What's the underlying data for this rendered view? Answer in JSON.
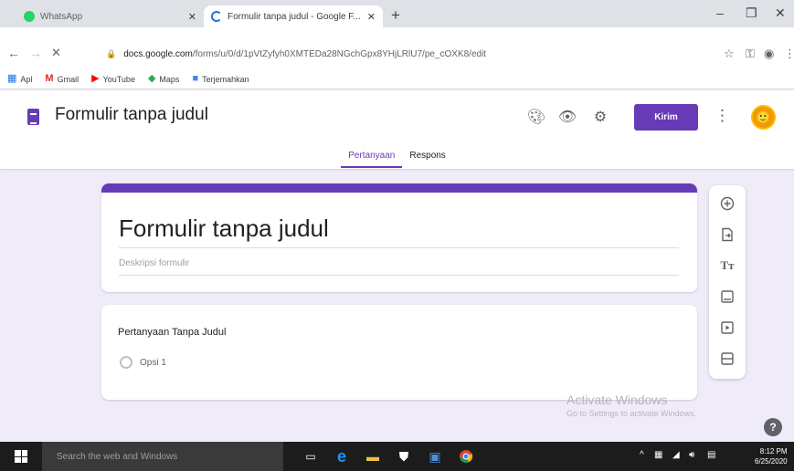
{
  "browser": {
    "tabs": [
      {
        "title": "WhatsApp",
        "active": false
      },
      {
        "title": "Formulir tanpa judul - Google F...",
        "active": true
      }
    ],
    "new_tab": "+",
    "window_controls": {
      "minimize": "–",
      "maximize": "❐",
      "close": "✕"
    },
    "address": {
      "host": "docs.google.com",
      "path": "/forms/u/0/d/1pVtZyfyh0XMTEDa28NGchGpx8YHjLRlU7/pe_cOXK8/edit"
    },
    "bookmarks": [
      {
        "icon": "apps-icon",
        "label": "Apl"
      },
      {
        "icon": "gmail-icon",
        "label": "Gmail"
      },
      {
        "icon": "youtube-icon",
        "label": "YouTube"
      },
      {
        "icon": "maps-icon",
        "label": "Maps"
      },
      {
        "icon": "translate-icon",
        "label": "Terjemahkan"
      }
    ]
  },
  "forms_header": {
    "doc_title": "Formulir tanpa judul",
    "send_label": "Kirim",
    "tabs": [
      {
        "label": "Pertanyaan",
        "active": true
      },
      {
        "label": "Respons",
        "active": false
      }
    ]
  },
  "form": {
    "title": "Formulir tanpa judul",
    "description_placeholder": "Deskripsi formulir",
    "questions": [
      {
        "title": "Pertanyaan Tanpa Judul",
        "options": [
          "Opsi 1"
        ]
      }
    ]
  },
  "side_tools": [
    "add-question-icon",
    "import-questions-icon",
    "add-title-icon",
    "add-image-icon",
    "add-video-icon",
    "add-section-icon"
  ],
  "watermark": {
    "title": "Activate Windows",
    "subtitle": "Go to Settings to activate Windows."
  },
  "taskbar": {
    "search_placeholder": "Search the web and Windows",
    "time": "8:12 PM",
    "date": "6/25/2020"
  },
  "colors": {
    "accent": "#673ab7",
    "background": "#f0ebf8",
    "taskbar": "#1c1c1c"
  }
}
